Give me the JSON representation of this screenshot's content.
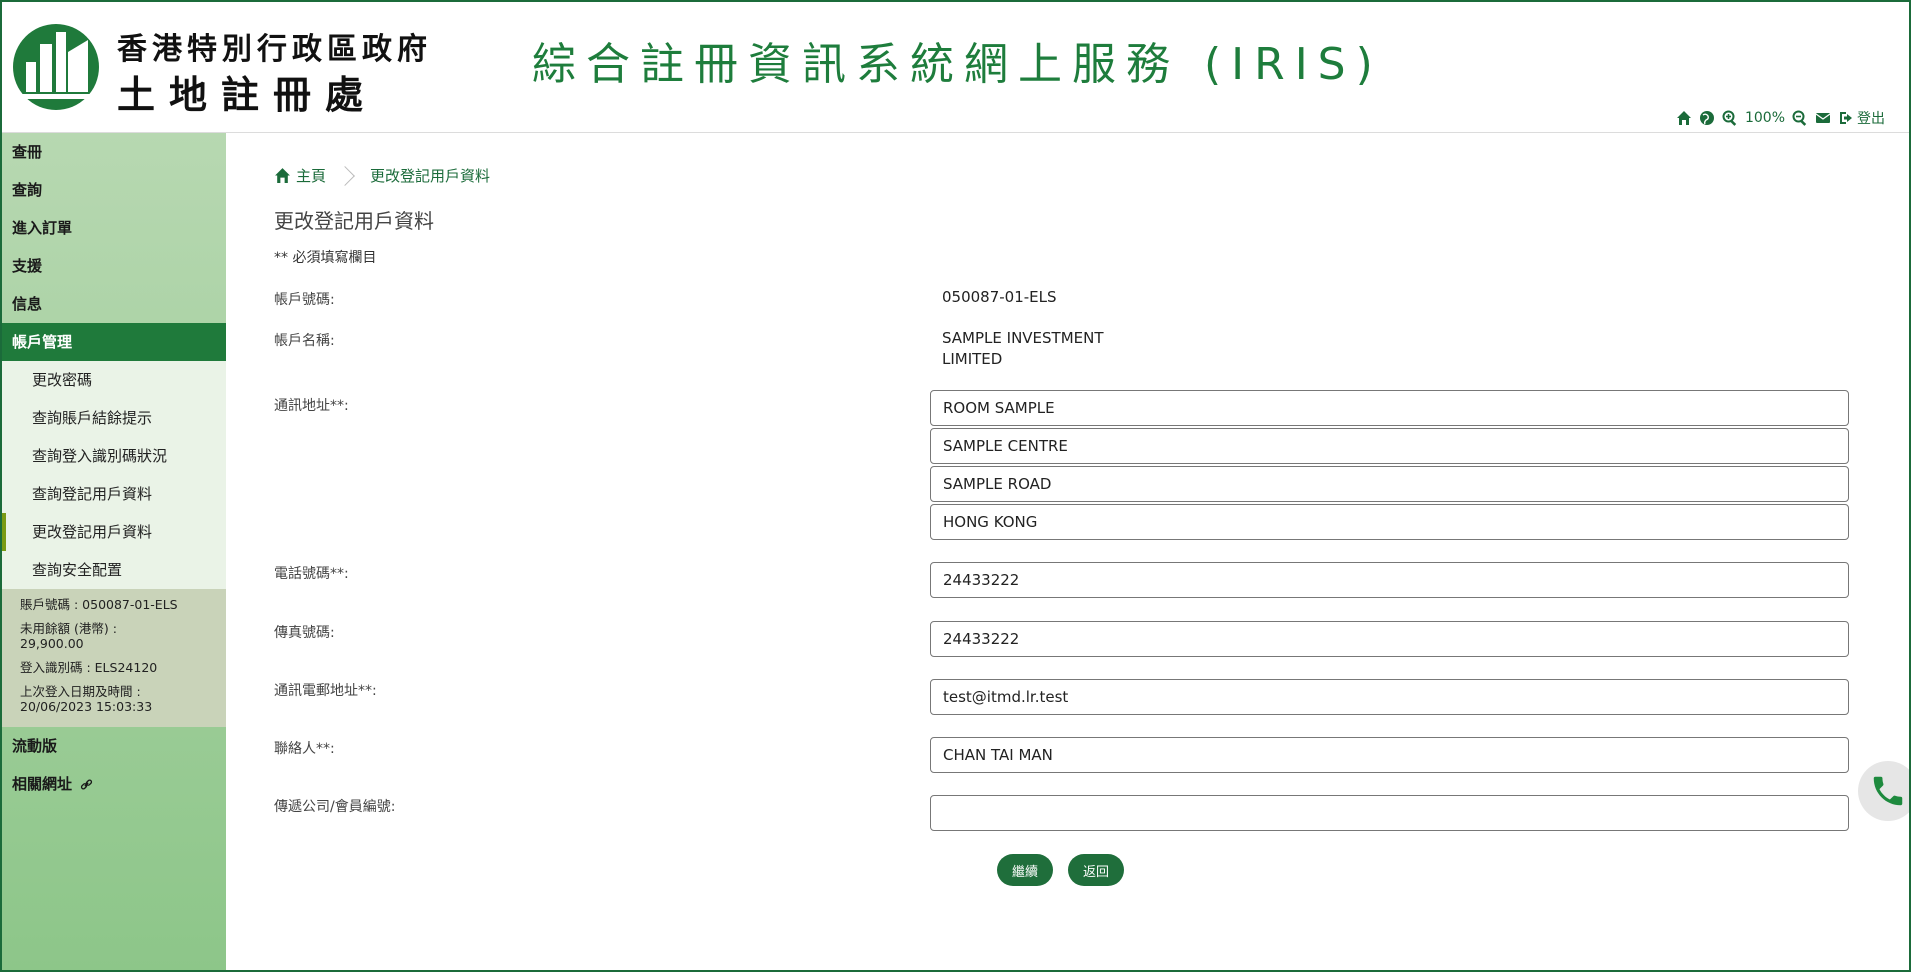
{
  "header": {
    "org_line1": "香港特別行政區政府",
    "org_line2": "土地註冊處",
    "system_title": "綜合註冊資訊系統網上服務 (IRIS)",
    "toolbar": {
      "zoom_level": "100%",
      "logout_label": "登出"
    }
  },
  "sidebar": {
    "nav_top": [
      "查冊",
      "查詢",
      "進入訂單",
      "支援",
      "信息"
    ],
    "active_section": "帳戶管理",
    "sub_items": [
      "更改密碼",
      "查詢賬戶結餘提示",
      "查詢登入識別碼狀況",
      "查詢登記用戶資料",
      "更改登記用戶資料",
      "查詢安全配置"
    ],
    "account_box": {
      "account_no": "賬戶號碼 : 050087-01-ELS",
      "balance_label": "未用餘額 (港幣) :",
      "balance_value": "29,900.00",
      "login_id": "登入識別碼 : ELS24120",
      "last_login_label": "上次登入日期及時間 :",
      "last_login_value": "20/06/2023 15:03:33"
    },
    "nav_bottom": [
      "流動版",
      "相關網址"
    ]
  },
  "breadcrumb": {
    "home": "主頁",
    "current": "更改登記用戶資料"
  },
  "page_title": "更改登記用戶資料",
  "required_note": "** 必須填寫欄目",
  "form": {
    "account_no_label": "帳戶號碼:",
    "account_no_value": "050087-01-ELS",
    "account_name_label": "帳戶名稱:",
    "account_name_line1": "SAMPLE INVESTMENT",
    "account_name_line2": "LIMITED",
    "address_label": "通訊地址**:",
    "address_lines": [
      "ROOM SAMPLE",
      "SAMPLE CENTRE",
      "SAMPLE ROAD",
      "HONG KONG"
    ],
    "phone_label": "電話號碼**:",
    "phone_value": "24433222",
    "fax_label": "傳真號碼:",
    "fax_value": "24433222",
    "email_label": "通訊電郵地址**:",
    "email_value": "test@itmd.lr.test",
    "contact_label": "聯絡人**:",
    "contact_value": "CHAN TAI MAN",
    "company_label": "傳遞公司/會員編號:",
    "company_value": ""
  },
  "buttons": {
    "continue": "繼續",
    "back": "返回"
  },
  "colors": {
    "brand_green": "#1f7a3b",
    "title_green": "#1e7d3c",
    "sidebar_light": "#b7d8b1"
  }
}
